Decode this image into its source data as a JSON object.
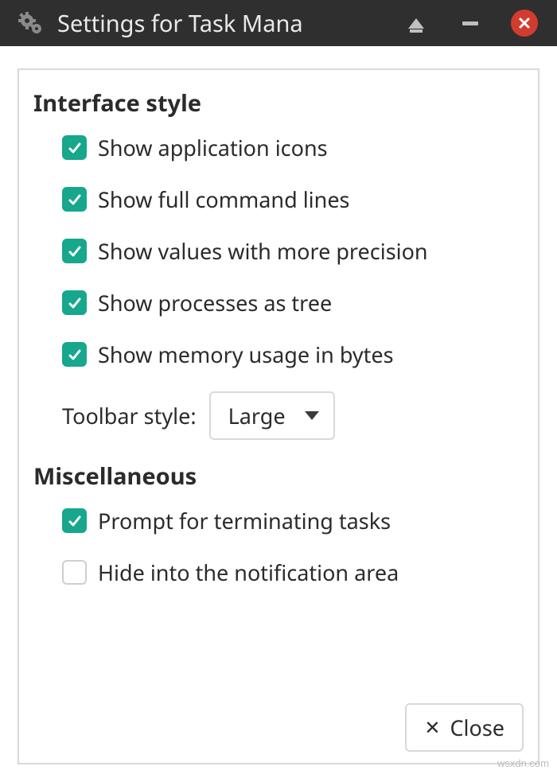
{
  "window": {
    "title": "Settings for Task Mana"
  },
  "sections": {
    "interface_title": "Interface style",
    "misc_title": "Miscellaneous"
  },
  "interface": {
    "show_app_icons": {
      "label": "Show application icons",
      "checked": true
    },
    "show_full_cmd": {
      "label": "Show full command lines",
      "checked": true
    },
    "show_precision": {
      "label": "Show values with more precision",
      "checked": true
    },
    "show_tree": {
      "label": "Show processes as tree",
      "checked": true
    },
    "show_bytes": {
      "label": "Show memory usage in bytes",
      "checked": true
    },
    "toolbar_label": "Toolbar style:",
    "toolbar_value": "Large"
  },
  "misc": {
    "prompt_terminate": {
      "label": "Prompt for terminating tasks",
      "checked": true
    },
    "hide_tray": {
      "label": "Hide into the notification area",
      "checked": false
    }
  },
  "footer": {
    "close_label": "Close"
  },
  "watermark": "wsxdn.com",
  "colors": {
    "accent": "#16a78c",
    "close": "#d23c2e",
    "titlebar": "#2f2f2f",
    "border": "#d9d9d9"
  }
}
